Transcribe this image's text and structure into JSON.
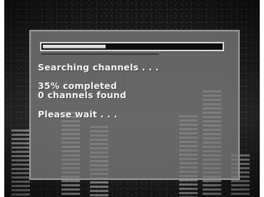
{
  "scan": {
    "status_text": "Searching channels . . .",
    "progress_text": "35% completed",
    "progress_fraction": 0.35,
    "channels_found_text": "0 channels found",
    "wait_text": "Please wait . . ."
  }
}
